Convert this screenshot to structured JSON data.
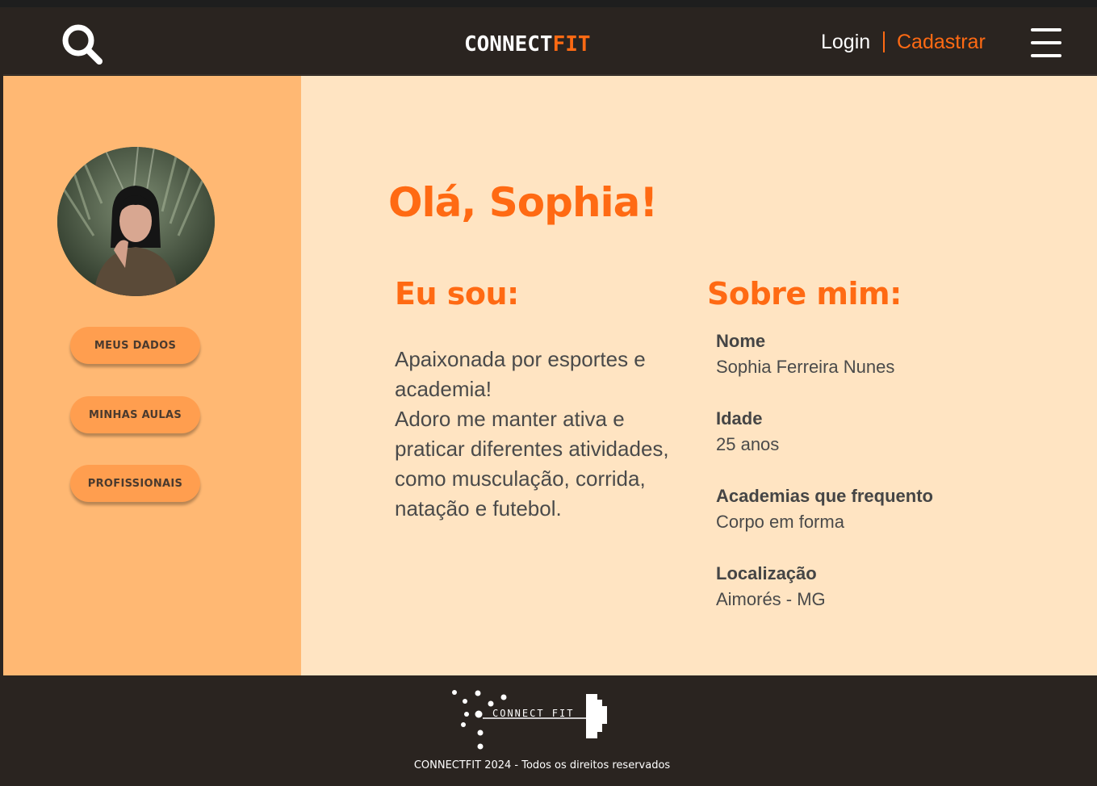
{
  "header": {
    "logo_primary": "CONNECT",
    "logo_accent": "FIT",
    "login_label": "Login",
    "register_label": "Cadastrar",
    "search_icon": "search-icon",
    "menu_icon": "hamburger-menu-icon"
  },
  "sidebar": {
    "avatar_alt": "profile photo",
    "buttons": [
      {
        "label": "MEUS DADOS"
      },
      {
        "label": "MINHAS AULAS"
      },
      {
        "label": "PROFISSIONAIS"
      }
    ]
  },
  "main": {
    "greeting": "Olá, Sophia!",
    "about_heading": "Eu sou:",
    "bio": "Apaixonada por esportes e academia!\nAdoro me manter ativa e praticar diferentes atividades, como musculação, corrida, natação e futebol.",
    "info_heading": "Sobre mim:",
    "fields": [
      {
        "label": "Nome",
        "value": "Sophia Ferreira Nunes"
      },
      {
        "label": "Idade",
        "value": "25 anos"
      },
      {
        "label": "Academias que frequento",
        "value": "Corpo em forma"
      },
      {
        "label": "Localização",
        "value": "Aimorés - MG"
      }
    ]
  },
  "footer": {
    "logo_text": "CONNECT FIT",
    "copyright": "CONNECTFIT 2024 - Todos os direitos reservados"
  },
  "colors": {
    "accent": "#ff6a13",
    "dark": "#2a2420",
    "sidebar": "#ffb873",
    "main_bg": "#ffe4c2",
    "button": "#ff9e4f"
  }
}
